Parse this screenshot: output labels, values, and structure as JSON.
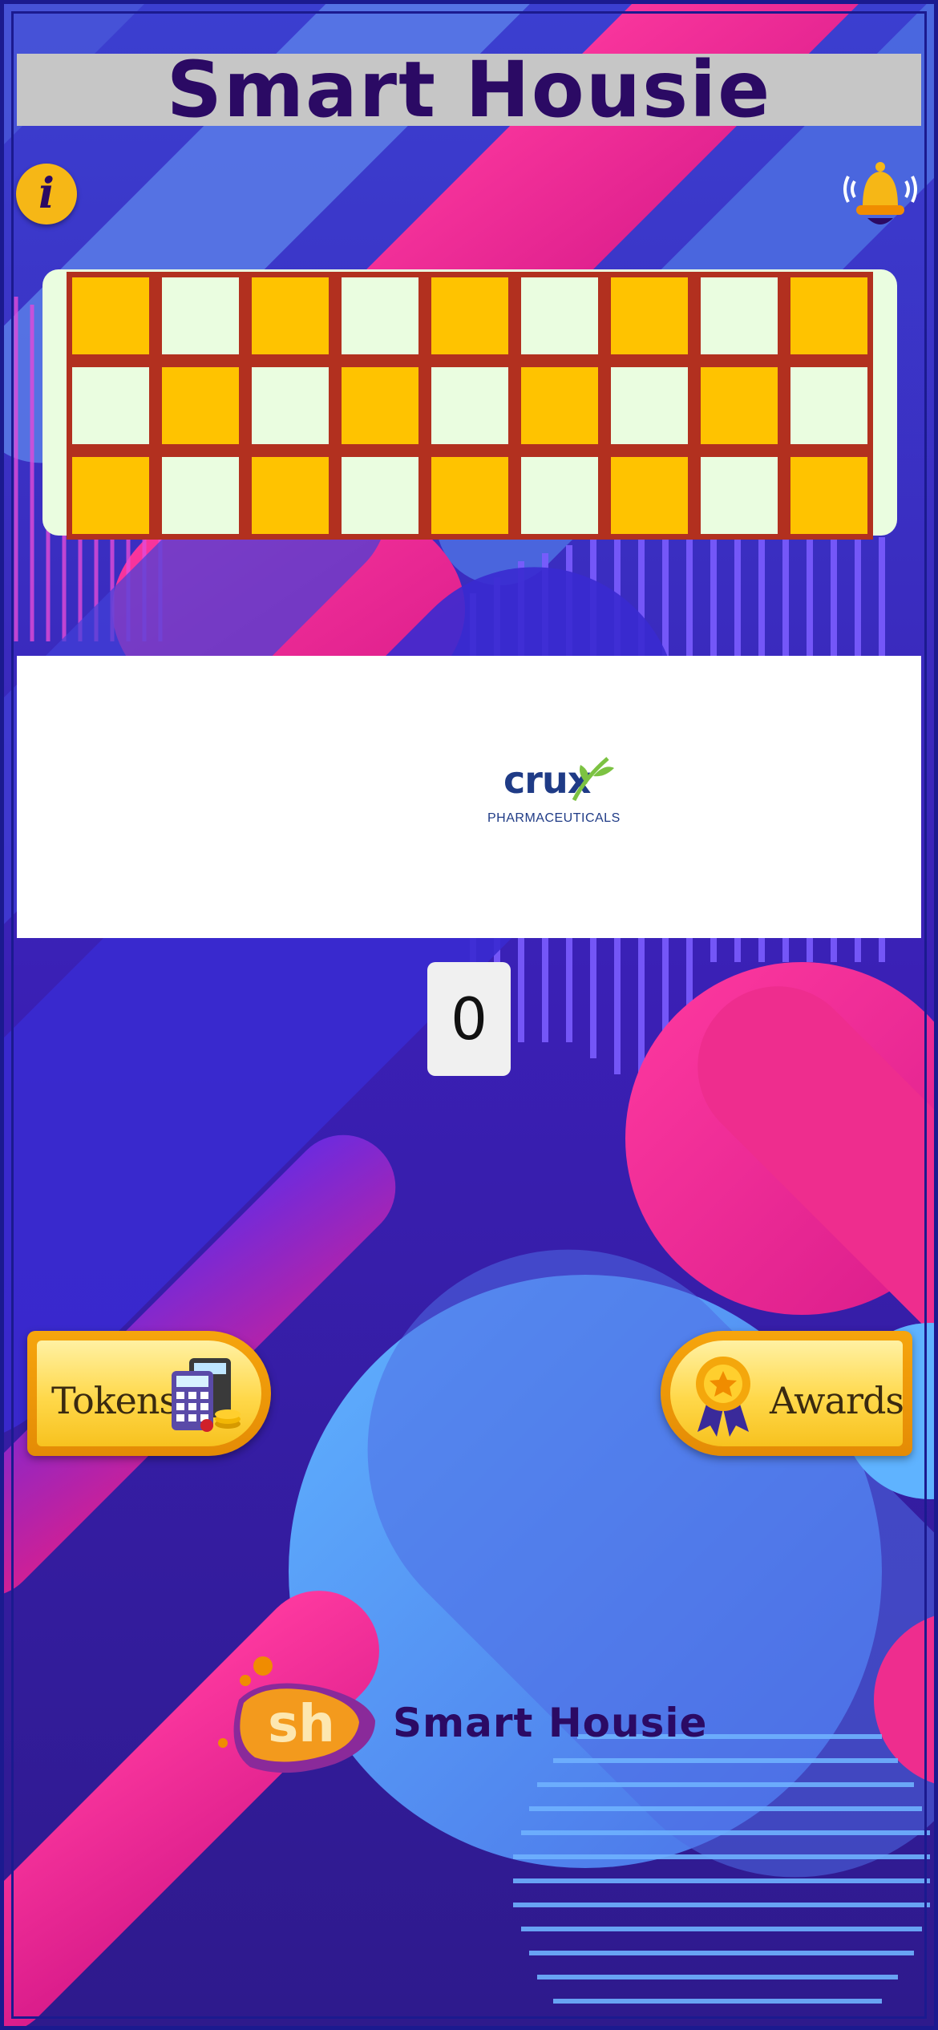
{
  "app": {
    "title": "Smart Housie"
  },
  "header": {
    "info_glyph": "i",
    "info_icon": "info-icon",
    "bell_icon": "bell-icon"
  },
  "ticket": {
    "rows": [
      [
        "on",
        "off",
        "on",
        "off",
        "on",
        "off",
        "on",
        "off",
        "on"
      ],
      [
        "off",
        "on",
        "off",
        "on",
        "off",
        "on",
        "off",
        "on",
        "off"
      ],
      [
        "on",
        "off",
        "on",
        "off",
        "on",
        "off",
        "on",
        "off",
        "on"
      ]
    ],
    "colors": {
      "marked": "#ffc300",
      "unmarked": "#eafde0",
      "border": "#b2301f"
    }
  },
  "ad": {
    "brand": "crux",
    "tagline": "PHARMACEUTICALS"
  },
  "counter": {
    "value": "0"
  },
  "buttons": {
    "tokens_label": "Tokens",
    "tokens_icon": "calculator-coins-icon",
    "awards_label": "Awards",
    "awards_icon": "award-ribbon-icon"
  },
  "footer": {
    "logo_text": "sh",
    "brand": "Smart Housie"
  },
  "colors": {
    "title_text": "#2b0a64",
    "accent": "#f6b716",
    "background": "#3a22b8",
    "pink": "#ee2d8e"
  }
}
